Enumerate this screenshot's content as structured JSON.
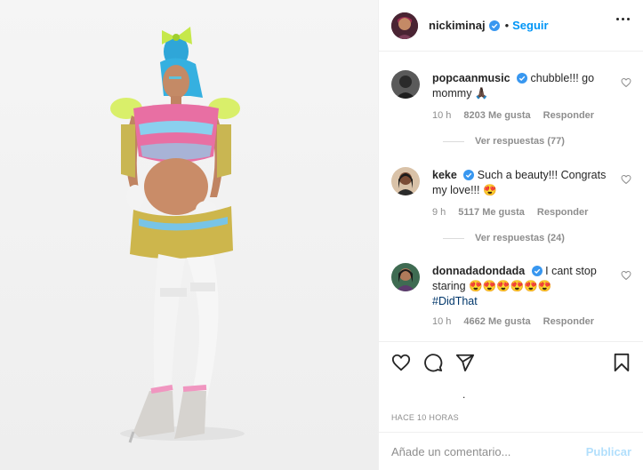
{
  "photo": {
    "alt_icon": "photo-of-person"
  },
  "header": {
    "username": "nickiminaj",
    "separator": "•",
    "follow_label": "Seguir",
    "more_icon": "more-options-icon"
  },
  "comments": [
    {
      "username": "popcaanmusic",
      "text": "chubble!!! go mommy 🙏🏿",
      "time": "10 h",
      "likes": "8203 Me gusta",
      "reply_label": "Responder",
      "view_replies": "Ver respuestas (77)"
    },
    {
      "username": "keke",
      "text": "Such a beauty!!! Congrats my love!!! 😍",
      "time": "9 h",
      "likes": "5117 Me gusta",
      "reply_label": "Responder",
      "view_replies": "Ver respuestas (24)"
    },
    {
      "username": "donnadadondada",
      "text": "I cant stop staring 😍😍😍😍😍😍",
      "hashtag": "#DidThat",
      "time": "10 h",
      "likes": "4662 Me gusta",
      "reply_label": "Responder"
    }
  ],
  "actions": {
    "like_icon": "heart-icon",
    "comment_icon": "comment-icon",
    "share_icon": "share-icon",
    "save_icon": "bookmark-icon",
    "likes_dot": "."
  },
  "time_ago": "HACE 10 HORAS",
  "add_comment": {
    "placeholder": "Añade un comentario...",
    "publish_label": "Publicar"
  },
  "colors": {
    "link_blue": "#0095f6",
    "publish_disabled": "#b2dffc",
    "muted": "#8e8e8e",
    "verified": "#3897f0"
  }
}
